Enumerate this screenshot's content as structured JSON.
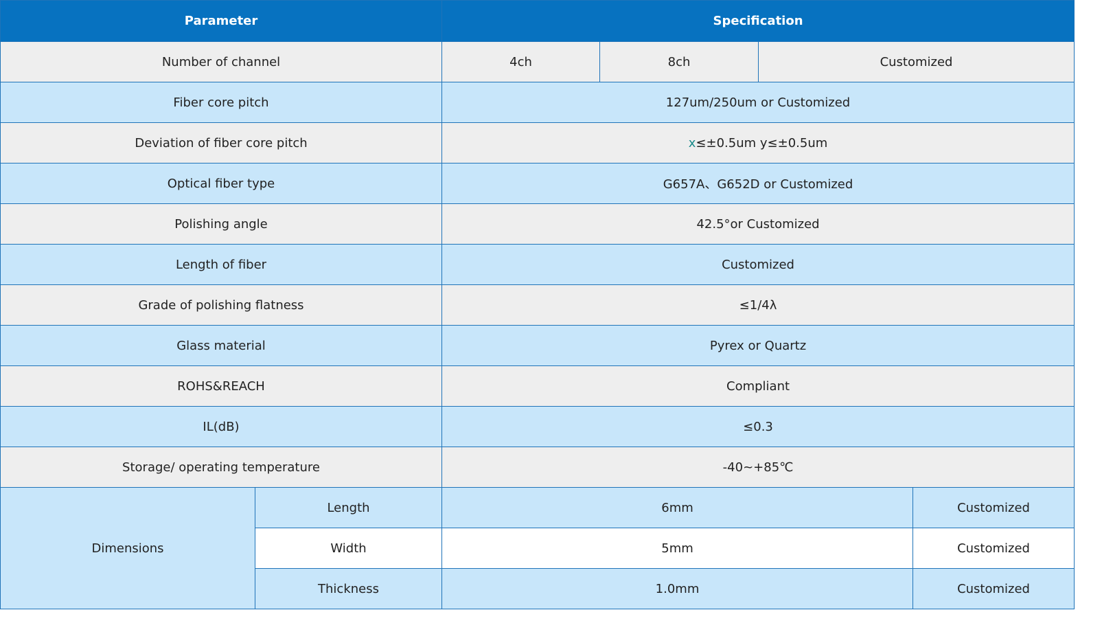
{
  "header": {
    "parameter": "Parameter",
    "specification": "Specification"
  },
  "channel": {
    "label": "Number of channel",
    "options": [
      "4ch",
      "8ch",
      "Customized"
    ]
  },
  "rows": [
    {
      "label": "Fiber core pitch",
      "value": "127um/250um or Customized"
    },
    {
      "label": "Deviation of fiber core pitch",
      "value_x": "x",
      "value": "≤±0.5um y≤±0.5um"
    },
    {
      "label": "Optical  fiber  type",
      "value": "G657A、G652D or Customized"
    },
    {
      "label": "Polishing  angle",
      "value": "42.5°or Customized"
    },
    {
      "label": "Length of fiber",
      "value": "Customized"
    },
    {
      "label": "Grade of polishing flatness",
      "value": "≤1/4λ"
    },
    {
      "label": "Glass material",
      "value": "Pyrex or Quartz"
    },
    {
      "label": "ROHS&REACH",
      "value": "Compliant"
    },
    {
      "label": "IL(dB)",
      "value": "≤0.3"
    },
    {
      "label": "Storage/ operating   temperature",
      "value": "-40~+85℃"
    }
  ],
  "dimensions": {
    "label": "Dimensions",
    "items": [
      {
        "name": "Length",
        "value": "6mm",
        "alt": "Customized"
      },
      {
        "name": "Width",
        "value": "5mm",
        "alt": "Customized"
      },
      {
        "name": "Thickness",
        "value": "1.0mm",
        "alt": "Customized"
      }
    ]
  }
}
